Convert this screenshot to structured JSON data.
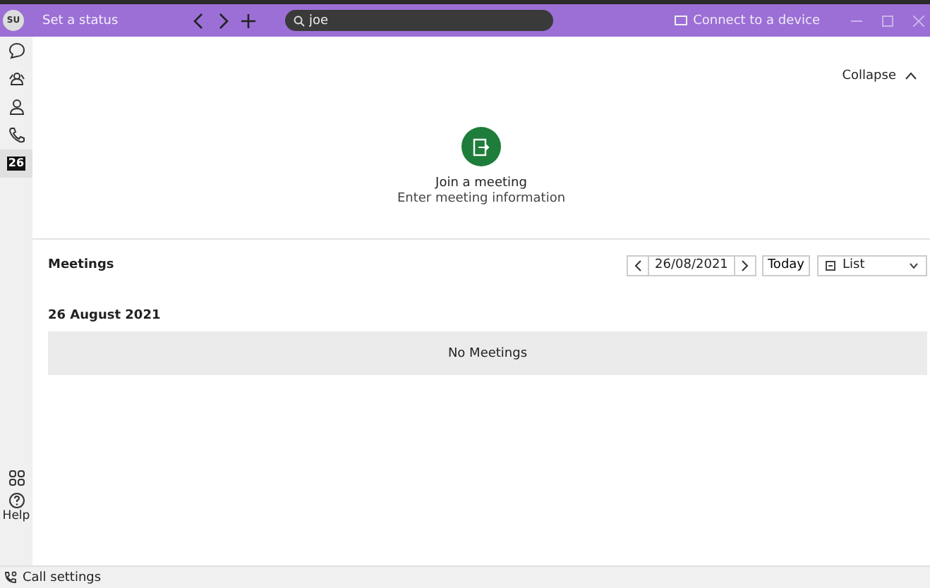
{
  "title_bar": {
    "avatar": "SU",
    "status": "Set a status",
    "search": {
      "value": "joe"
    },
    "connect": "Connect to a device"
  },
  "sidebar": {
    "items": [
      {
        "kind": "chat",
        "selected": false
      },
      {
        "kind": "teams",
        "selected": false
      },
      {
        "kind": "contacts",
        "selected": false
      },
      {
        "kind": "calls",
        "selected": false
      },
      {
        "kind": "calendar",
        "label": "26",
        "selected": true
      }
    ],
    "bottom": [
      {
        "kind": "apps"
      },
      {
        "kind": "help",
        "label": "Help"
      }
    ]
  },
  "join": {
    "collapse": "Collapse",
    "title": "Join a meeting",
    "subtitle": "Enter meeting information"
  },
  "meetings": {
    "title": "Meetings",
    "date": "26/08/2021",
    "today": "Today",
    "view": "List",
    "day": "26 August 2021",
    "empty": "No Meetings"
  },
  "status_bar": {
    "call_settings": "Call settings"
  }
}
